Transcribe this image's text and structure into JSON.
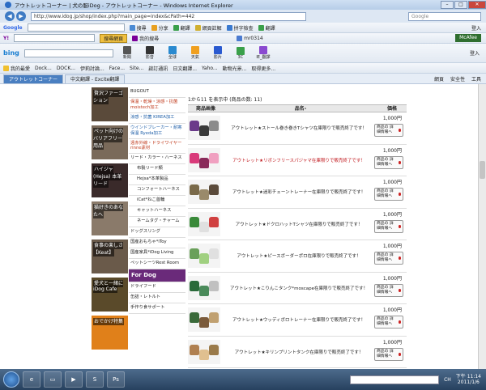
{
  "window": {
    "title": "アウトレットコーナー | 犬の服iDog - アウトレットコーナー - Windows Internet Explorer"
  },
  "address": {
    "url": "http://www.idog.jp/shop/index.php?main_page=index&cPath=442",
    "search_placeholder": "Google"
  },
  "toolbar1": {
    "google": "Google",
    "items": [
      "搜尋",
      "分享",
      "翻譯",
      "網頁註解",
      "拼字檢查",
      "翻譯",
      "登入"
    ]
  },
  "toolbar2": {
    "yahoo": "Y!",
    "search_btn": "搜尋網頁",
    "items": [
      "我的搜尋",
      "mr0314",
      "McAfee"
    ]
  },
  "toolbar3": {
    "bing": "bing",
    "items": [
      "新聞",
      "影音",
      "全球",
      "天氣",
      "影片",
      "3C",
      "IE_翻譯"
    ],
    "login": "登入"
  },
  "favorites": {
    "label": "我的最愛",
    "items": [
      "Dock...",
      "DOCK...",
      "伊莉討論...",
      "Face...",
      "Site...",
      "啟訂通訊",
      "日文翻譯...",
      "Yaho...",
      "動物光景...",
      "取得更多..."
    ]
  },
  "tabs": [
    {
      "label": "アウトレットコーナー"
    },
    {
      "label": "中文翻譯 - Excite翻譯"
    }
  ],
  "tabtools": [
    "網頁",
    "安全性",
    "工具"
  ],
  "banners": [
    {
      "text": "贅沢ファーゴション",
      "color": "#5a4a3a"
    },
    {
      "text": "ペット向けの バリアフリー用品",
      "color": "#7a6a5a"
    },
    {
      "text": "ハイジャ(Hejsa) 本革リード",
      "color": "#3a2a2a"
    },
    {
      "text": "猫好きのあなたへ",
      "color": "#8a7a6a"
    },
    {
      "text": "食事の楽しさ 【Keat】",
      "color": "#6a5a4a"
    },
    {
      "text": "愛犬と一緒に iDog Cafe",
      "color": "#5a4a2a"
    },
    {
      "text": "おでかけ特集",
      "color": "#e0801a"
    }
  ],
  "menu": [
    {
      "label": "BUGOUT",
      "cls": ""
    },
    {
      "label": "保温・乾燥・涼感・抗菌 moistech加工",
      "cls": "red"
    },
    {
      "label": "涼感・抗菌 KIREA加工",
      "cls": "blue"
    },
    {
      "label": "ウインドブレーカー・耐寒保温 Ryeda加工",
      "cls": "blue"
    },
    {
      "label": "遠赤外線・ドライワイヤー rinne素材",
      "cls": "red"
    },
    {
      "label": "リード・カラー・ハーネス",
      "cls": ""
    },
    {
      "label": "布製リード類",
      "cls": "sub"
    },
    {
      "label": "Hejsa*本革製品",
      "cls": "sub"
    },
    {
      "label": "コンフォートハーネス",
      "cls": "sub"
    },
    {
      "label": "iCat*ねこ首輪",
      "cls": "sub"
    },
    {
      "label": "キャットハーネス",
      "cls": "sub"
    },
    {
      "label": "ネームタグ・チャーム",
      "cls": "sub"
    },
    {
      "label": "ドッグスリング",
      "cls": ""
    },
    {
      "label": "国産おもちゃ*iToy",
      "cls": ""
    },
    {
      "label": "国産家具*iDog Living",
      "cls": ""
    },
    {
      "label": "ペットシーツRest Room",
      "cls": ""
    },
    {
      "label": "For Dog",
      "cls": "fordog"
    },
    {
      "label": "ドライフード",
      "cls": ""
    },
    {
      "label": "缶詰・レトルト",
      "cls": ""
    },
    {
      "label": "手作り食サポート",
      "cls": ""
    }
  ],
  "main": {
    "count_text": "1から11 を表示中 (商品の数: 11)",
    "headers": {
      "image": "商品画像",
      "name": "品名-",
      "price": "価格"
    },
    "detail_label": "商品の 詳細情報へ",
    "products": [
      {
        "name": "アウトレット★ストール巻き巻きTシャツ在庫限りで販売終了です！",
        "price": "1,000円",
        "red": false,
        "colors": [
          "#6b3a8a",
          "#3a3a3a",
          "#8b8b8b"
        ]
      },
      {
        "name": "アウトレット★リボンフリースパジャマ在庫限りで販売終了です！",
        "price": "1,000円",
        "red": true,
        "colors": [
          "#d93a7a",
          "#8a2a5a",
          "#f0a0c0"
        ]
      },
      {
        "name": "アウトレット★迷彩チェーントレーナー在庫限りで販売終了です！",
        "price": "1,000円",
        "red": false,
        "colors": [
          "#7a6a4a",
          "#9a8a6a",
          "#5a4a3a"
        ]
      },
      {
        "name": "アウトレット★ドクロハットTシャツ在庫限りで販売終了です！",
        "price": "1,000円",
        "red": false,
        "colors": [
          "#3a8a3a",
          "#e0e0e0",
          "#d04040"
        ]
      },
      {
        "name": "アウトレット★ピースボーダーポロ在庫限りで販売終了です！",
        "price": "1,000円",
        "red": false,
        "colors": [
          "#6aa05a",
          "#a0d080",
          "#e0e0e0"
        ]
      },
      {
        "name": "アウトレット★こりんこタンク*moscape在庫限りで販売終了です！",
        "price": "1,000円",
        "red": false,
        "colors": [
          "#2a6a3a",
          "#4a8a5a",
          "#c0c0c0"
        ]
      },
      {
        "name": "アウトレット★ウッディボロトレーナー在庫限りで販売終了です！",
        "price": "1,000円",
        "red": false,
        "colors": [
          "#3a6a3a",
          "#7a5a3a",
          "#c0a070"
        ]
      },
      {
        "name": "アウトレット★キリンプリントタンク在庫限りで販売終了です！",
        "price": "1,000円",
        "red": false,
        "colors": [
          "#b08050",
          "#e0c090",
          "#9a7a4a"
        ]
      }
    ]
  },
  "taskbar": {
    "time": "下午 11:14",
    "date": "2011/1/6",
    "lang": "CH"
  }
}
